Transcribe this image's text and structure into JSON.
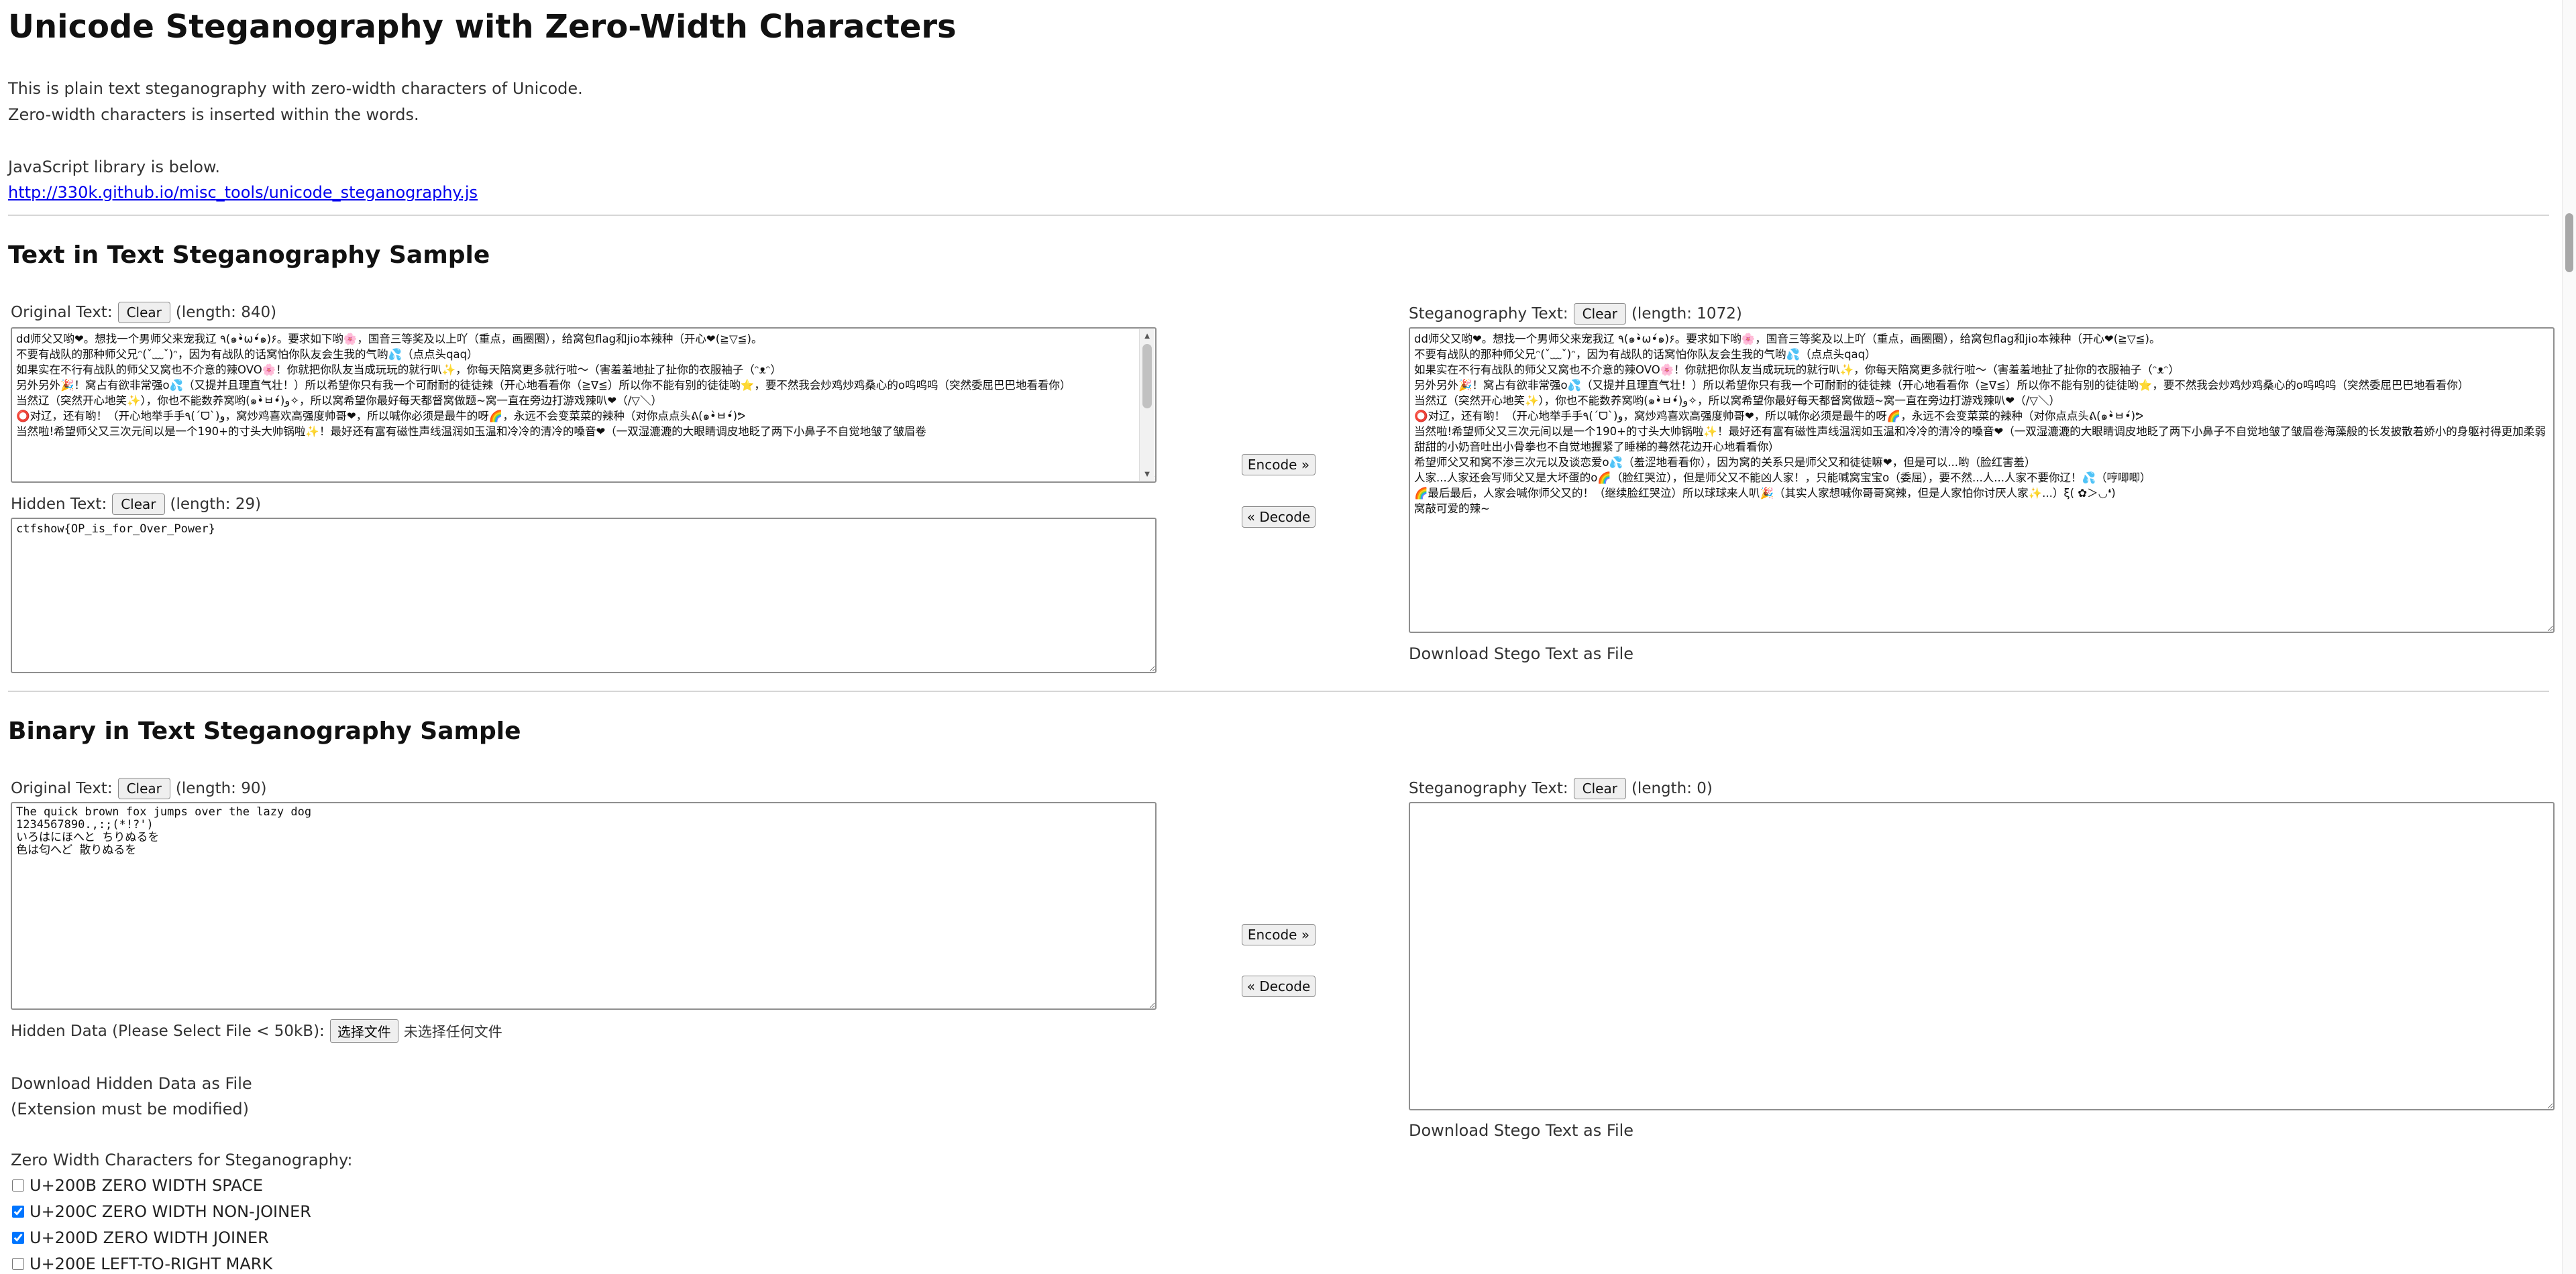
{
  "page": {
    "title": "Unicode Steganography with Zero-Width Characters",
    "intro_line1": "This is plain text steganography with zero-width characters of Unicode.",
    "intro_line2": "Zero-width characters is inserted within the words.",
    "intro_line3": "JavaScript library is below.",
    "library_link": "http://330k.github.io/misc_tools/unicode_steganography.js"
  },
  "text_section": {
    "heading": "Text in Text Steganography Sample",
    "original_label": "Original Text:",
    "original_clear": "Clear",
    "original_length": "(length: 840)",
    "original_value": "dd师父又哟❤。想找一个男师父来宠我辽 ٩(๑•̀ω•́๑)۶。要求如下哟🌸，国音三等奖及以上吖（重点，画圈圈），给窝包flag和jio本辣种（开心❤(≧▽≦)。\n不要有战队的那种师父兄ᵔ(ˇ﹏ˇ)ᵔ，因为有战队的话窝怕你队友会生我的气哟💦（点点头qaq）\n如果实在不行有战队的师父又窝也不介意的辣OVO🌸！你就把你队友当成玩玩的就行叭✨，你每天陪窝更多就行啦～（害羞羞地扯了扯你的衣服袖子（ᵔᴥᵔ）\n另外另外🎉！窝占有欲非常强o💦（又提并且理直气壮！）所以希望你只有我一个可耐耐的徒徒辣（开心地看看你（≧∇≦）所以你不能有别的徒徒哟⭐，要不然我会炒鸡炒鸡桑心的o呜呜呜（突然委屈巴巴地看看你）\n当然辽（突然开心地笑✨），你也不能数养窝哟(๑•̀ㅂ•́)و✧，所以窝希望你最好每天都督窝做题~窝一直在旁边打游戏辣叭❤（/▽＼）\n⭕对辽，还有哟！（开心地举手手٩(ˊᗜˋ)و，窝炒鸡喜欢高强度帅哥❤，所以喊你必须是最牛的呀🌈，永远不会变菜菜的辣种（对你点点头ᕕ(๑•̀ㅂ•́)ᕗ\n当然啦!希望师父又三次元间以是一个190+的寸头大帅锅啦✨！最好还有富有磁性声线温润如玉温和冷冷的清冷的嗓音❤（一双湿漉漉的大眼睛调皮地眨了两下小鼻子不自觉地皱了皱眉卷",
    "hidden_label": "Hidden Text:",
    "hidden_clear": "Clear",
    "hidden_length": "(length: 29)",
    "hidden_value": "ctfshow{OP_is_for_Over_Power}",
    "encode_label": "Encode »",
    "decode_label": "« Decode",
    "stego_label": "Steganography Text:",
    "stego_clear": "Clear",
    "stego_length": "(length: 1072)",
    "stego_value": "dd师父又哟❤。想找一个男师父来宠我辽 ٩(๑•̀ω•́๑)۶。要求如下哟🌸，国音三等奖及以上吖（重点，画圈圈），给窝包flag和jio本辣种（开心❤(≧▽≦)。\n不要有战队的那种师父兄ᵔ(ˇ﹏ˇ)ᵔ，因为有战队的话窝怕你队友会生我的气哟💦（点点头qaq）\n如果实在不行有战队的师父又窝也不介意的辣OVO🌸！你就把你队友当成玩玩的就行叭✨，你每天陪窝更多就行啦～（害羞羞地扯了扯你的衣服袖子（ᵔᴥᵔ）\n另外另外🎉！窝占有欲非常强o💦（又提并且理直气壮！）所以希望你只有我一个可耐耐的徒徒辣（开心地看看你（≧∇≦）所以你不能有别的徒徒哟⭐，要不然我会炒鸡炒鸡桑心的o呜呜呜（突然委屈巴巴地看看你）\n当然辽（突然开心地笑✨），你也不能数养窝哟(๑•̀ㅂ•́)و✧，所以窝希望你最好每天都督窝做题~窝一直在旁边打游戏辣叭❤（/▽＼）\n⭕对辽，还有哟！（开心地举手手٩(ˊᗜˋ)و，窝炒鸡喜欢高强度帅哥❤，所以喊你必须是最牛的呀🌈，永远不会变菜菜的辣种（对你点点头ᕕ(๑•̀ㅂ•́)ᕗ\n当然啦!希望师父又三次元间以是一个190+的寸头大帅锅啦✨！最好还有富有磁性声线温润如玉温和冷冷的清冷的嗓音❤（一双湿漉漉的大眼睛调皮地眨了两下小鼻子不自觉地皱了皱眉卷海藻般的长发披散着娇小的身躯衬得更加柔弱甜甜的小奶音吐出小骨拳也不自觉地握紧了睡梯的蓦然花边开心地看看你）\n希望师父又和窝不渗三次元以及谈恋爱o💦（羞涩地看看你），因为窝的关系只是师父又和徒徒嘛❤，但是可以...哟（脸红害羞）\n人家...人家还会写师父又是大坏蛋的o🌈（脸红哭泣），但是师父又不能凶人家！，只能喊窝宝宝o（委屈），要不然...人...人家不要你辽！💦（哼唧唧）\n🌈最后最后，人家会喊你师父又的！（继续脸红哭泣）所以球球来人叭🎉（其实人家想喊你哥哥窝辣，但是人家怕你讨厌人家✨...）ξ( ✿＞◡❛)\n窝敲可爱的辣~",
    "download_label": "Download Stego Text as File"
  },
  "binary_section": {
    "heading": "Binary in Text Steganography Sample",
    "original_label": "Original Text:",
    "original_clear": "Clear",
    "original_length": "(length: 90)",
    "original_value": "The quick brown fox jumps over the lazy dog\n1234567890.,:;(*!?')\nいろはにほへと ちりぬるを\n色は匂へど 散りぬるを",
    "hidden_label": "Hidden Data (Please Select File < 50kB):",
    "file_button": "选择文件",
    "file_status": "未选择任何文件",
    "download_hidden_label": "Download Hidden Data as File",
    "extension_note": "(Extension must be modified)",
    "encode_label": "Encode »",
    "decode_label": "« Decode",
    "stego_label": "Steganography Text:",
    "stego_clear": "Clear",
    "stego_length": "(length: 0)",
    "stego_value": "",
    "download_label": "Download Stego Text as File"
  },
  "zero_width": {
    "heading": "Zero Width Characters for Steganography:",
    "options": [
      {
        "label": "U+200B ZERO WIDTH SPACE",
        "checked": false
      },
      {
        "label": "U+200C ZERO WIDTH NON-JOINER",
        "checked": true
      },
      {
        "label": "U+200D ZERO WIDTH JOINER",
        "checked": true
      },
      {
        "label": "U+200E LEFT-TO-RIGHT MARK",
        "checked": false
      }
    ]
  }
}
